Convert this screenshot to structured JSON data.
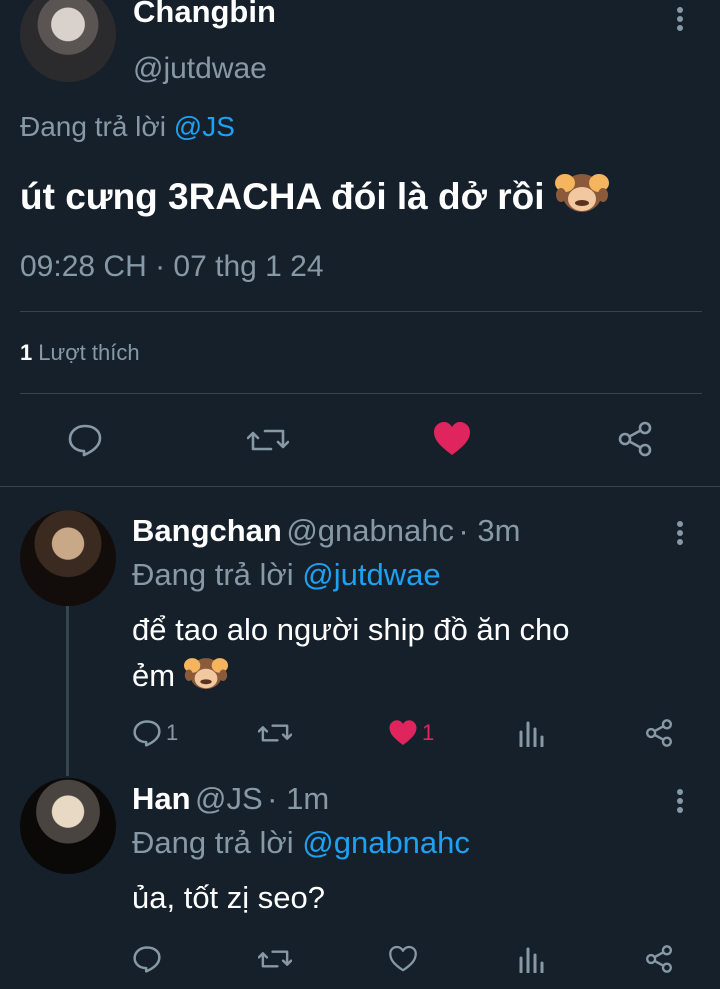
{
  "main_tweet": {
    "author_name": "Changbin",
    "author_handle": "@jutdwae",
    "replying_label": "Đang trả lời",
    "replying_to": "@JS",
    "text": "út cưng 3RACHA đói là dở rồi",
    "emoji": "🙈",
    "timestamp": "09:28 CH · 07 thg 1 24",
    "likes_count": "1",
    "likes_label": "Lượt thích",
    "liked": true
  },
  "replies": [
    {
      "name": "Bangchan",
      "handle": "@gnabnahc",
      "time": "· 3m",
      "replying_label": "Đang trả lời",
      "replying_to": "@jutdwae",
      "text_line1": "để tao alo người ship đồ ăn cho",
      "text_line2": "ẻm",
      "emoji": "🙈",
      "reply_count": "1",
      "like_count": "1",
      "liked": true
    },
    {
      "name": "Han",
      "handle": "@JS",
      "time": "· 1m",
      "replying_label": "Đang trả lời",
      "replying_to": "@gnabnahc",
      "text": "ủa, tốt zị seo?",
      "liked": false
    }
  ],
  "colors": {
    "background": "#15202b",
    "accent": "#1da1f2",
    "like": "#e0245e",
    "muted": "#8899a6",
    "divider": "#38444d"
  },
  "icons": [
    "more-vertical-icon",
    "reply-icon",
    "retweet-icon",
    "heart-icon",
    "share-icon",
    "analytics-icon"
  ]
}
